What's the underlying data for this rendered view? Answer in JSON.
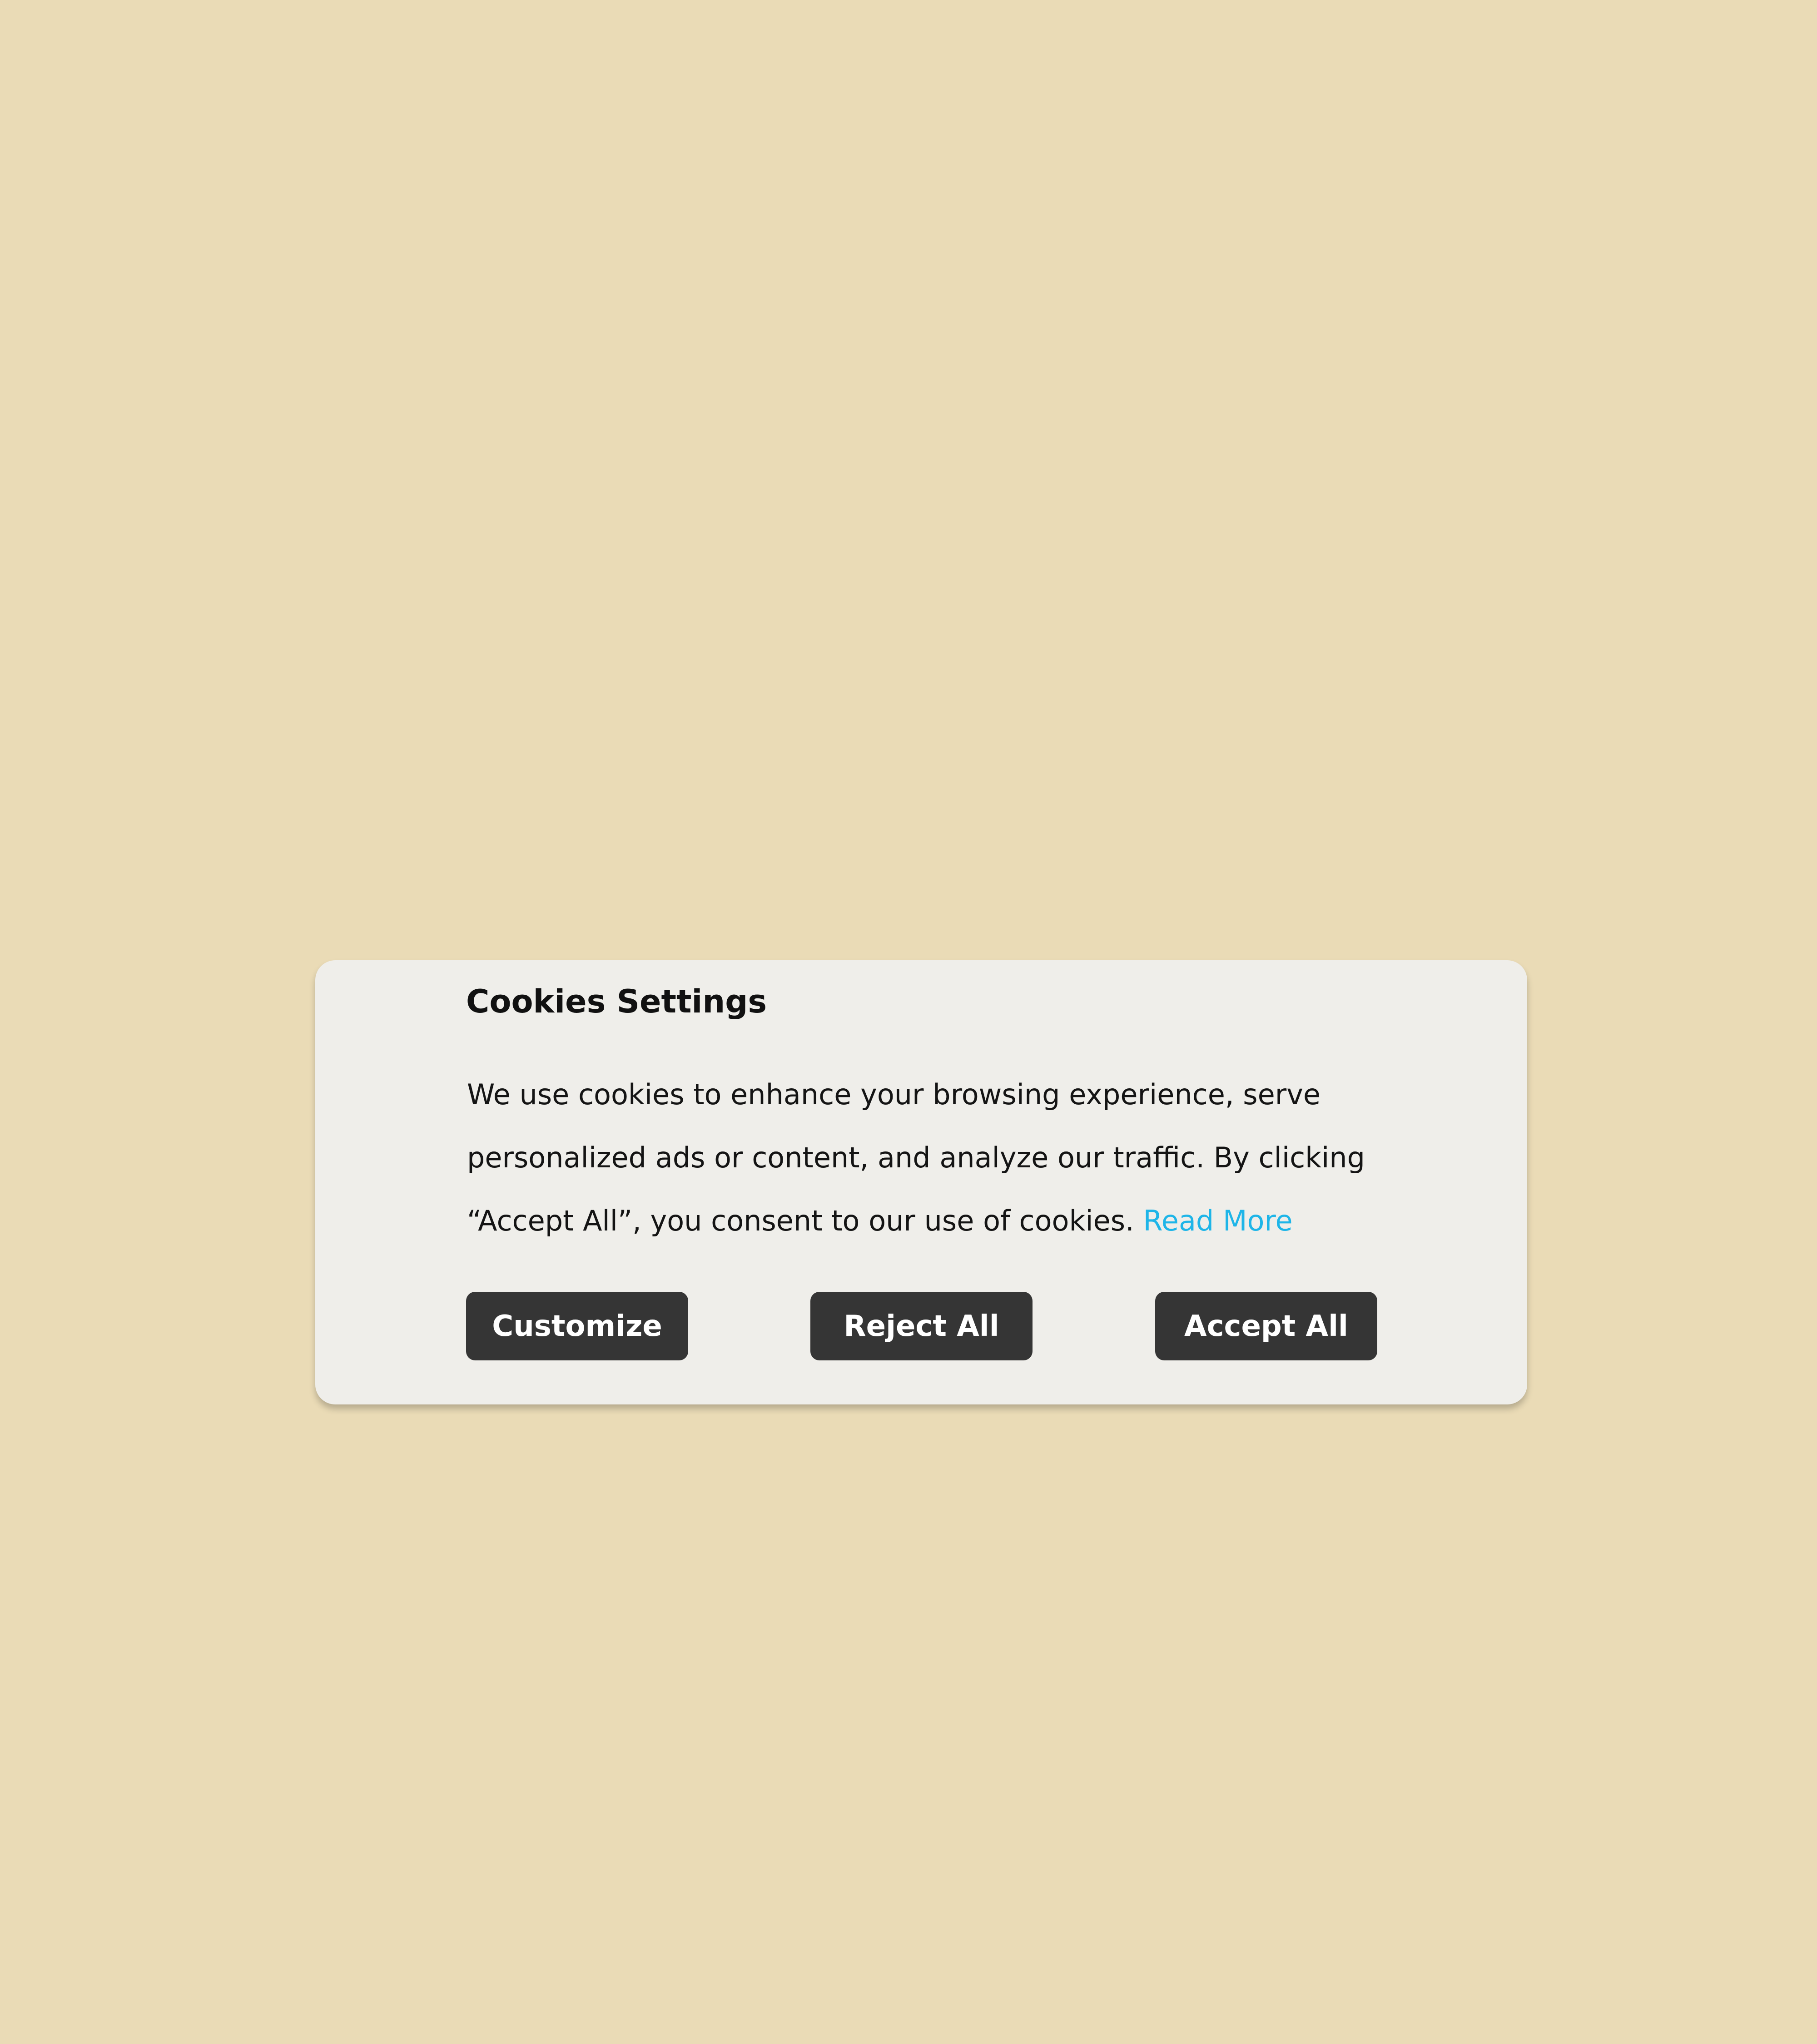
{
  "background_color": "#EADBB6",
  "dialog": {
    "title": "Cookies Settings",
    "body_lines": [
      "We use cookies to enhance your browsing experience, serve",
      "personalized ads or content, and analyze our traffic. By clicking",
      "“Accept All”, you consent to our use of cookies."
    ],
    "read_more_label": "Read More",
    "link_color": "#1EB5E8",
    "buttons": {
      "customize_label": "Customize",
      "reject_label": "Reject All",
      "accept_label": "Accept All"
    },
    "button_color": "#353535",
    "panel_color": "#EFEEEA"
  }
}
